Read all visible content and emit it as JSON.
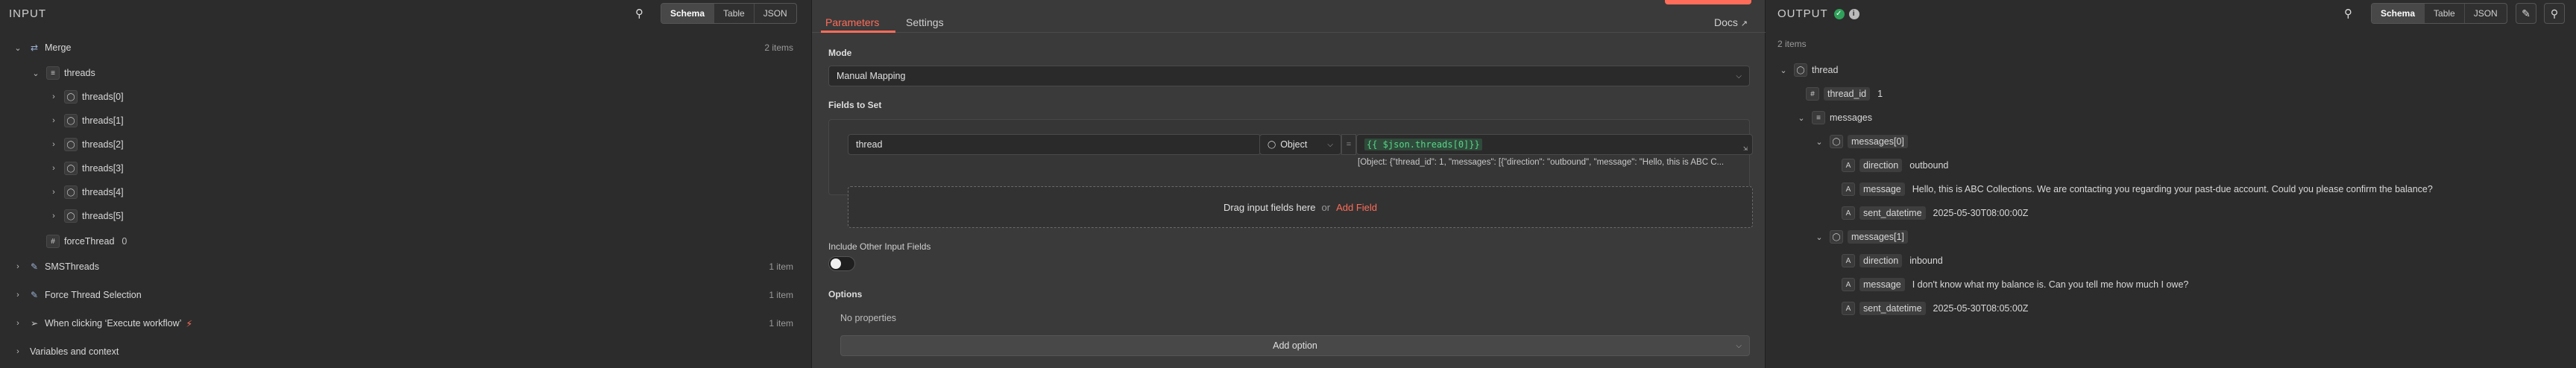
{
  "input": {
    "title": "INPUT",
    "view_tabs": [
      "Schema",
      "Table",
      "JSON"
    ],
    "active_tab": "Schema",
    "nodes": [
      {
        "name": "Merge",
        "count": "2 items"
      },
      {
        "name": "SMSThreads",
        "count": "1 item"
      },
      {
        "name": "Force Thread Selection",
        "count": "1 item"
      },
      {
        "name": "When clicking ‘Execute workflow’",
        "count": "1 item"
      },
      {
        "name": "Variables and context"
      }
    ],
    "merge_fields": {
      "threads": "threads",
      "thread_items": [
        "threads[0]",
        "threads[1]",
        "threads[2]",
        "threads[3]",
        "threads[4]",
        "threads[5]"
      ],
      "force_thread": {
        "name": "forceThread",
        "value": "0"
      }
    }
  },
  "center": {
    "tabs": [
      "Parameters",
      "Settings"
    ],
    "active_tab": "Parameters",
    "docs_label": "Docs",
    "mode_label": "Mode",
    "mode_value": "Manual Mapping",
    "fields_label": "Fields to Set",
    "field": {
      "name": "thread",
      "type": "Object",
      "expression": "{{ $json.threads[0]}}",
      "preview": "[Object: {\"thread_id\": 1, \"messages\": [{\"direction\": \"outbound\", \"message\": \"Hello, this is ABC C..."
    },
    "drop_zone": {
      "text": "Drag input fields here",
      "or": "or",
      "add": "Add Field"
    },
    "include_other_label": "Include Other Input Fields",
    "options_label": "Options",
    "no_properties": "No properties",
    "add_option": "Add option",
    "accent": "#ff6d5a"
  },
  "output": {
    "title": "OUTPUT",
    "count": "2 items",
    "view_tabs": [
      "Schema",
      "Table",
      "JSON"
    ],
    "active_tab": "Schema",
    "tree": {
      "thread": "thread",
      "thread_id": {
        "key": "thread_id",
        "value": "1"
      },
      "messages": "messages",
      "m0": {
        "label": "messages[0]",
        "direction": {
          "key": "direction",
          "value": "outbound"
        },
        "message": {
          "key": "message",
          "value": "Hello, this is ABC Collections. We are contacting you regarding your past-due account. Could you please confirm the balance?"
        },
        "sent": {
          "key": "sent_datetime",
          "value": "2025-05-30T08:00:00Z"
        }
      },
      "m1": {
        "label": "messages[1]",
        "direction": {
          "key": "direction",
          "value": "inbound"
        },
        "message": {
          "key": "message",
          "value": "I don't know what my balance is. Can you tell me how much I owe?"
        },
        "sent": {
          "key": "sent_datetime",
          "value": "2025-05-30T08:05:00Z"
        }
      }
    }
  }
}
